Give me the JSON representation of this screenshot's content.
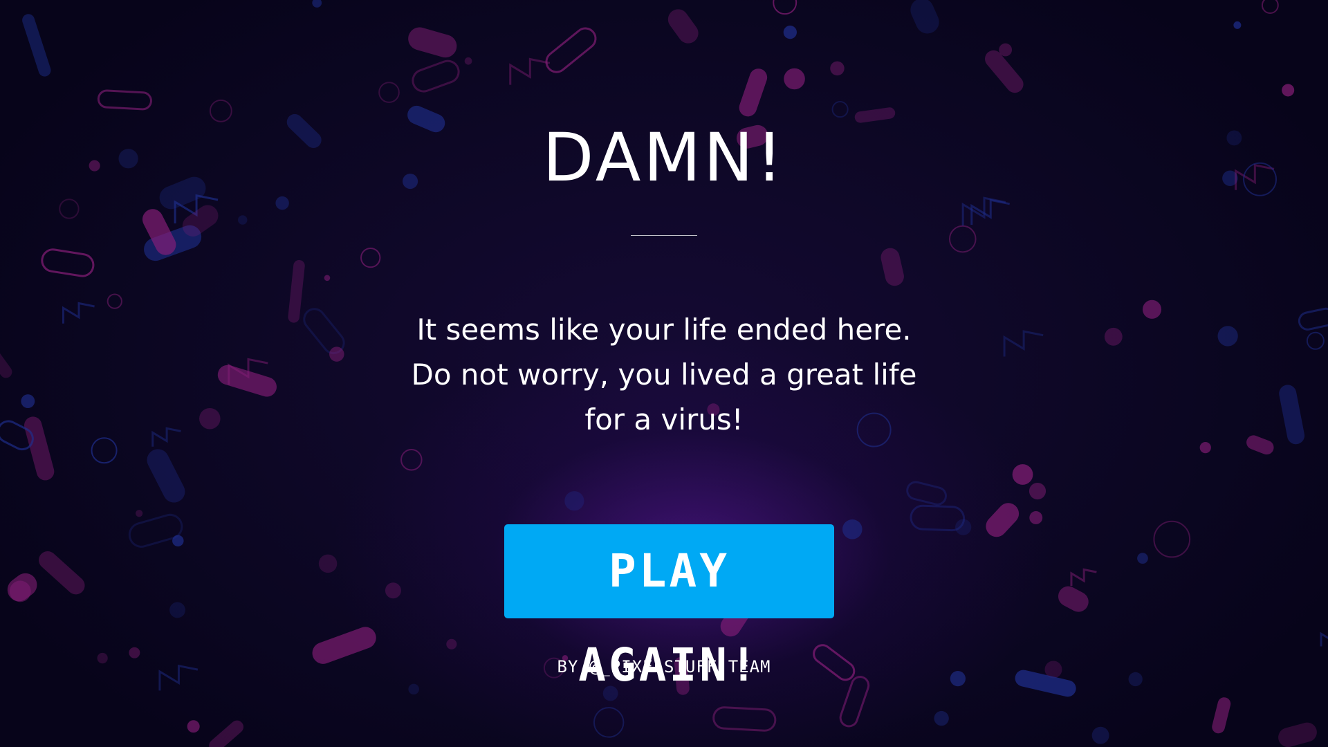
{
  "screen": {
    "title": "DAMN!",
    "message_lines": [
      "It seems like your life ended here.",
      "Do not worry, you lived a great life",
      "for a virus!"
    ],
    "play_again_label": "PLAY AGAIN!",
    "credit": "BY @_PIXELSTUFF TEAM"
  },
  "colors": {
    "background": "#0a0618",
    "button": "#00a9f4",
    "text": "#ffffff",
    "decor_pink": "#8a1f7a",
    "decor_blue": "#1f2f8f"
  }
}
